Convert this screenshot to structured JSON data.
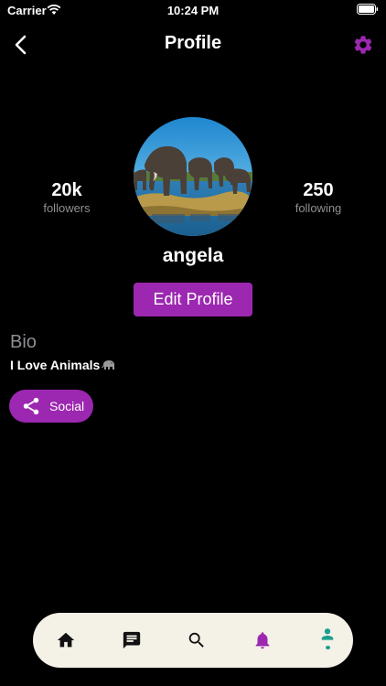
{
  "status_bar": {
    "carrier": "Carrier",
    "time": "10:24 PM"
  },
  "nav": {
    "title": "Profile",
    "back_icon": "chevron-left-icon",
    "settings_icon": "gear-icon"
  },
  "profile": {
    "avatar": "elephants-photo",
    "followers_count": "20k",
    "followers_label": "followers",
    "following_count": "250",
    "following_label": "following",
    "username": "angela",
    "edit_button_label": "Edit Profile"
  },
  "bio": {
    "heading": "Bio",
    "text": "I Love Animals",
    "emoji_icon": "elephant-icon"
  },
  "social": {
    "label": "Social",
    "icon": "share-icon"
  },
  "bottom_nav": {
    "items": [
      {
        "name": "home",
        "icon": "home-icon"
      },
      {
        "name": "messages",
        "icon": "message-icon"
      },
      {
        "name": "search",
        "icon": "search-icon"
      },
      {
        "name": "notifications",
        "icon": "bell-icon"
      },
      {
        "name": "profile",
        "icon": "person-icon",
        "active": true
      }
    ]
  },
  "colors": {
    "accent": "#9c27b0",
    "nav_background": "#f4f1e7",
    "active_tab": "#1a9e8e",
    "muted_text": "#8e8e93"
  }
}
